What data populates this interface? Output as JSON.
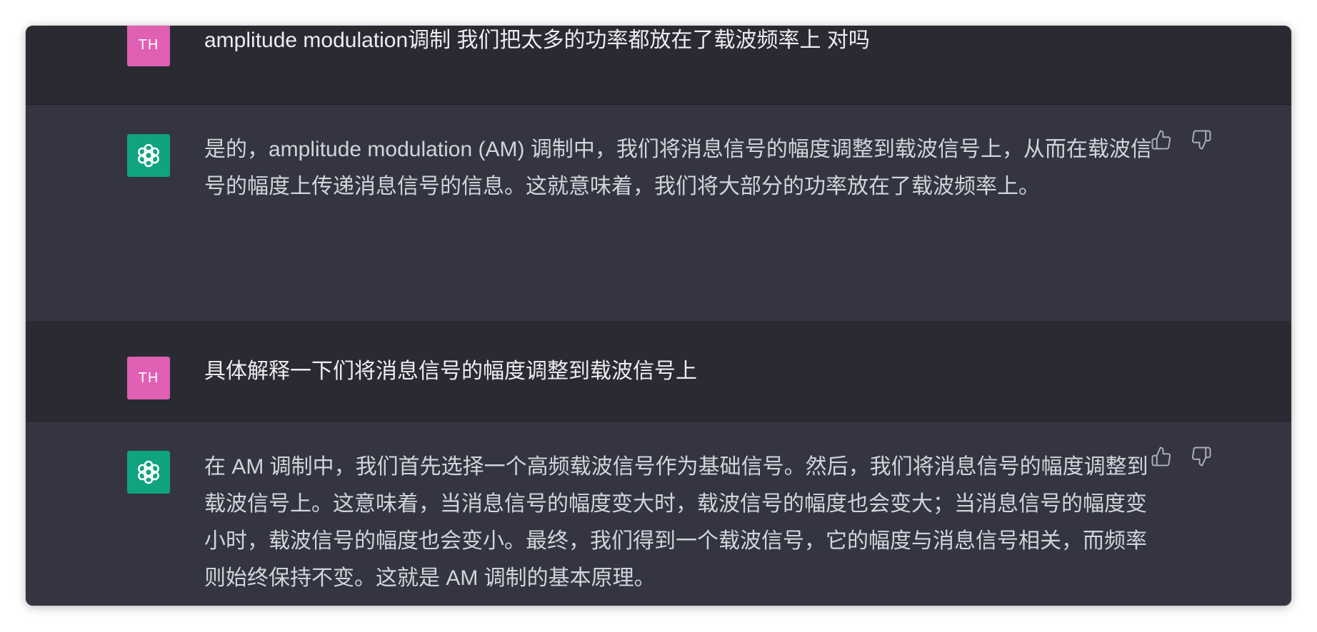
{
  "conversation": {
    "messages": [
      {
        "role": "user",
        "avatar_text": "TH",
        "text": "amplitude modulation调制 我们把太多的功率都放在了载波频率上 对吗"
      },
      {
        "role": "assistant",
        "avatar_icon": "openai-logo-icon",
        "text": "是的，amplitude modulation (AM) 调制中，我们将消息信号的幅度调整到载波信号上，从而在载波信号的幅度上传递消息信号的信息。这就意味着，我们将大部分的功率放在了载波频率上。"
      },
      {
        "role": "user",
        "avatar_text": "TH",
        "text": "具体解释一下们将消息信号的幅度调整到载波信号上"
      },
      {
        "role": "assistant",
        "avatar_icon": "openai-logo-icon",
        "text": "在 AM 调制中，我们首先选择一个高频载波信号作为基础信号。然后，我们将消息信号的幅度调整到载波信号上。这意味着，当消息信号的幅度变大时，载波信号的幅度也会变大；当消息信号的幅度变小时，载波信号的幅度也会变小。最终，我们得到一个载波信号，它的幅度与消息信号相关，而频率则始终保持不变。这就是 AM 调制的基本原理。"
      }
    ]
  },
  "feedback_icons": [
    "thumbs-up-icon",
    "thumbs-down-icon"
  ],
  "colors": {
    "user_bg": "#2a2b32",
    "assistant_bg": "#343541",
    "user_avatar": "#e060b4",
    "assistant_avatar": "#10a37f",
    "text_user": "#ececf1",
    "text_assistant": "#d1d5db",
    "icon": "#acacbe"
  }
}
